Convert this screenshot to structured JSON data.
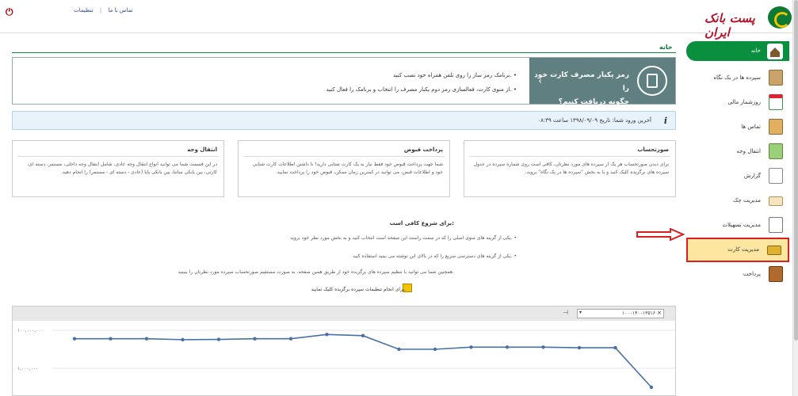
{
  "topbar": {
    "settings": "تنظیمات",
    "contact": "تماس با ما",
    "separator": "|"
  },
  "logo": {
    "text": "پست بانک ایران"
  },
  "breadcrumb": {
    "home": "خانه"
  },
  "sidebar": {
    "items": [
      {
        "label": "خانه"
      },
      {
        "label": "سپرده ها در یک نگاه"
      },
      {
        "label": "روزشمار مالی"
      },
      {
        "label": "تماس ها"
      },
      {
        "label": "انتقال وجه"
      },
      {
        "label": "گزارش"
      },
      {
        "label": "مدیریت چک"
      },
      {
        "label": "مدیریت تسهیلات"
      },
      {
        "label": "مدیریت کارت"
      },
      {
        "label": "پرداخت"
      }
    ]
  },
  "banner": {
    "title1": "رمز یکبار مصرف کارت خود را",
    "title2": "چگونه دریافت کنیم؟",
    "bullet1": "برنامک رمز ساز را روی تلفن همراه خود نصب کنید. •",
    "bullet2": "از منوی کارت، فعالسازی رمز دوم یکبار مصرف را انتخاب و برنامک را فعال کنید. •"
  },
  "info": {
    "last_login": "آخرین ورود شما: تاریخ ۱۳۹۸/۰۹/۰۹ ساعت ۰۸:۳۹"
  },
  "cards": [
    {
      "title": "صورتحساب",
      "body": "برای دیدن صورتحساب هر یک از سپرده های مورد نظرتان، کافی است روی شماره سپرده در جدول سپرده های برگزیده کلیک کنید و یا به بخش \"سپرده ها در یک نگاه\" بروید."
    },
    {
      "title": "پرداخت قبوض",
      "body": "شما جهت پرداخت قبوض خود فقط نیاز به یک کارت شتابی دارید! با داشتن اطلاعات کارت شتابی خود و اطلاعات قبض، می توانید در کمترین زمان ممکن، قبوض خود را پرداخت نمایید."
    },
    {
      "title": "انتقال وجه",
      "body": "در این قسمت شما می توانید انواع انتقال وجه عادی، شامل انتقال وجه داخلی، مستمر، دسته ای، کارتی، بین بانکی ساتنا، بین بانکی پایا (عادی - دسته ای - مستمر) را انجام دهید."
    }
  ],
  "start": {
    "title": "برای شروع کافی است:",
    "b1": "یکی از گزینه های منوی اصلی را که در سمت راست این صفحه است انتخاب کنید و به بخش مورد نظر خود بروید.",
    "b2": "یکی از گزینه های دسترسی سریع را که در بالای این نوشته می بینید استفاده کنید.",
    "tail1": "همچنین شما می توانید با تنظیم سپرده های برگزیده خود از طریق همین صفحه، به صورت مستقیم صورتحساب سپرده مورد نظرتان را ببینید.",
    "tail2": "برای انجام تنظیمات سپرده برگزیده کلیک نمایید."
  },
  "chart_select": {
    "value": "۱۰۰۰۱۴۰۰۱۳۵۱۶"
  },
  "chart_data": {
    "type": "line",
    "y_ticks": [
      "۱۰۰,۰۰۰,۰۰۰",
      "۱,۰۰۰,۰۰۰"
    ],
    "y_scale": "log",
    "values": [
      36000000,
      36000000,
      36000000,
      32000000,
      33000000,
      36000000,
      36000000,
      60000000,
      52000000,
      10000000,
      10000000,
      13000000,
      13000000,
      13000000,
      12000000,
      12000000,
      100000
    ],
    "color": "#4a6fa5"
  },
  "colors": {
    "brand_green": "#0a8f3e",
    "brand_red": "#b5122b",
    "highlight": "#fde7a0",
    "arrow": "#d9201f"
  }
}
